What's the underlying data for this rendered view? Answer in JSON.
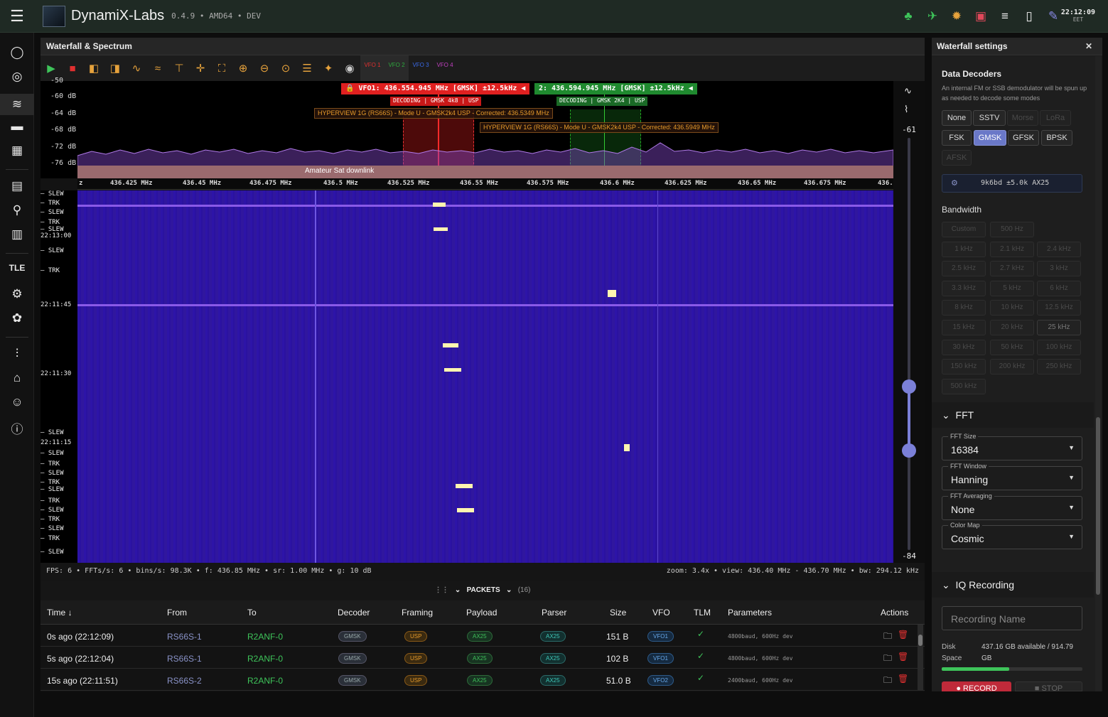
{
  "app": {
    "title": "DynamiX-Labs",
    "version": "0.4.9 • AMD64 • DEV",
    "clock": "22:12:09",
    "tz": "EET"
  },
  "panel": {
    "title": "Waterfall & Spectrum"
  },
  "vfos": [
    {
      "label": "VFO 1",
      "color": "#e03030"
    },
    {
      "label": "VFO 2",
      "color": "#2eaa3e"
    },
    {
      "label": "VFO 3",
      "color": "#3a6ae8"
    },
    {
      "label": "VFO 4",
      "color": "#c040c0"
    }
  ],
  "spectrum": {
    "db_labels": [
      "-50",
      "-60 dB",
      "-64 dB",
      "-68 dB",
      "-72 dB",
      "-76 dB"
    ],
    "vfo1_banner": "VFO1: 436.554.945 MHz [GMSK] ±12.5kHz",
    "vfo2_banner": "2: 436.594.945 MHz [GMSK] ±12.5kHz",
    "vfo1_decoding": "DECODING | GMSK 4k8 | USP",
    "vfo2_decoding": "DECODING | GMSK 2K4 | USP",
    "sat1": "HYPERVIEW 1G (RS66S) - Mode U - GMSK2k4 USP - Corrected: 436.5349 MHz",
    "sat2": "HYPERVIEW 1G (RS66S) - Mode U - GMSK2k4 USP - Corrected: 436.5949 MHz",
    "band": "Amateur Sat downlink",
    "freq_labels": [
      "z",
      "436.425 MHz",
      "436.45 MHz",
      "436.475 MHz",
      "436.5 MHz",
      "436.525 MHz",
      "436.55 MHz",
      "436.575 MHz",
      "436.6 MHz",
      "436.625 MHz",
      "436.65 MHz",
      "436.675 MHz",
      "436."
    ],
    "scale_top": "-61",
    "scale_bottom": "-84"
  },
  "timeline": [
    {
      "t": "— SLEW"
    },
    {
      "t": "— TRK"
    },
    {
      "t": "— SLEW"
    },
    {
      "t": "— TRK"
    },
    {
      "t": "— SLEW"
    },
    {
      "t": "22:13:00"
    },
    {
      "t": "— SLEW"
    },
    {
      "t": "— TRK"
    },
    {
      "t": "22:11:45"
    },
    {
      "t": "22:11:30"
    },
    {
      "t": "— SLEW"
    },
    {
      "t": "22:11:15"
    },
    {
      "t": "— SLEW"
    },
    {
      "t": "— TRK"
    },
    {
      "t": "— SLEW"
    },
    {
      "t": "— TRK"
    },
    {
      "t": "— SLEW"
    },
    {
      "t": "— TRK"
    },
    {
      "t": "— SLEW"
    },
    {
      "t": "— TRK"
    },
    {
      "t": "— SLEW"
    },
    {
      "t": "— TRK"
    },
    {
      "t": "— SLEW"
    }
  ],
  "status": {
    "left": "FPS:     6 • FFTs/s:     6 • bins/s: 98.3K • f: 436.85 MHz • sr: 1.00 MHz • g: 10 dB",
    "right": "zoom: 3.4x • view: 436.40 MHz - 436.70 MHz • bw: 294.12 kHz"
  },
  "packets": {
    "title": "PACKETS",
    "count": "(16)",
    "columns": [
      "Time",
      "From",
      "To",
      "Decoder",
      "Framing",
      "Payload",
      "Parser",
      "Size",
      "VFO",
      "TLM",
      "Parameters",
      "Actions"
    ],
    "rows": [
      {
        "time": "0s ago (22:12:09)",
        "from": "RS66S-1",
        "to": "R2ANF-0",
        "decoder": "GMSK",
        "framing": "USP",
        "payload": "AX25",
        "parser": "AX25",
        "size": "151 B",
        "vfo": "VFO1",
        "tlm": "✓",
        "params": "4800baud, 600Hz dev"
      },
      {
        "time": "5s ago (22:12:04)",
        "from": "RS66S-1",
        "to": "R2ANF-0",
        "decoder": "GMSK",
        "framing": "USP",
        "payload": "AX25",
        "parser": "AX25",
        "size": "102 B",
        "vfo": "VFO1",
        "tlm": "✓",
        "params": "4800baud, 600Hz dev"
      },
      {
        "time": "15s ago (22:11:51)",
        "from": "RS66S-2",
        "to": "R2ANF-0",
        "decoder": "GMSK",
        "framing": "USP",
        "payload": "AX25",
        "parser": "AX25",
        "size": "51.0 B",
        "vfo": "VFO2",
        "tlm": "✓",
        "params": "2400baud, 600Hz dev"
      }
    ]
  },
  "settings": {
    "title": "Waterfall settings",
    "decoders_title": "Data Decoders",
    "decoders_desc": "An internal FM or SSB demodulator will be spun up as needed to decode some modes",
    "decoders": [
      "None",
      "SSTV",
      "Morse",
      "LoRa",
      "FSK",
      "GMSK",
      "GFSK",
      "BPSK",
      "AFSK"
    ],
    "decoder_setting": "9k6bd ±5.0k AX25",
    "bw_title": "Bandwidth",
    "bandwidths": [
      "Custom",
      "500 Hz",
      "1 kHz",
      "2.1 kHz",
      "2.4 kHz",
      "2.5 kHz",
      "2.7 kHz",
      "3 kHz",
      "3.3 kHz",
      "5 kHz",
      "6 kHz",
      "8 kHz",
      "10 kHz",
      "12.5 kHz",
      "15 kHz",
      "20 kHz",
      "25 kHz",
      "30 kHz",
      "50 kHz",
      "100 kHz",
      "150 kHz",
      "200 kHz",
      "250 kHz",
      "500 kHz"
    ],
    "fft_title": "FFT",
    "fft_size_label": "FFT Size",
    "fft_size": "16384",
    "fft_window_label": "FFT Window",
    "fft_window": "Hanning",
    "fft_avg_label": "FFT Averaging",
    "fft_avg": "None",
    "cmap_label": "Color Map",
    "cmap": "Cosmic",
    "iq_title": "IQ Recording",
    "rec_placeholder": "Recording Name",
    "disk_label": "Disk Space",
    "disk_value": "437.16 GB available / 914.79 GB",
    "disk_used": 0.48,
    "record": "RECORD",
    "stop": "STOP"
  }
}
